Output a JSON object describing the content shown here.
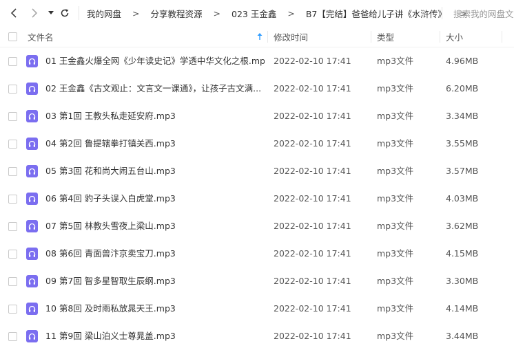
{
  "breadcrumb": {
    "items": [
      "我的网盘",
      "分享教程资源",
      "023 王金鑫",
      "B7【完结】爸爸给儿子讲《水浒传》"
    ]
  },
  "search": {
    "placeholder": "搜索我的网盘文件"
  },
  "columns": {
    "name": "文件名",
    "time": "修改时间",
    "type": "类型",
    "size": "大小"
  },
  "icons": {
    "back": "back-arrow-icon",
    "forward": "forward-arrow-icon",
    "dropdown": "dropdown-icon",
    "refresh": "refresh-icon",
    "sort": "sort-ascending-icon",
    "file": "audio-file-icon"
  },
  "colors": {
    "file_icon": "#7b6ef0",
    "sort_arrow": "#2f9cff"
  },
  "files": [
    {
      "name": "01 王金鑫火爆全网《少年读史记》学透中华文化之根.mp3",
      "time": "2022-02-10 17:41",
      "type": "mp3文件",
      "size": "4.96MB"
    },
    {
      "name": "02 王金鑫《古文观止：文言文一课通》，让孩子古文满...",
      "time": "2022-02-10 17:41",
      "type": "mp3文件",
      "size": "6.20MB"
    },
    {
      "name": "03 第1回 王教头私走延安府.mp3",
      "time": "2022-02-10 17:41",
      "type": "mp3文件",
      "size": "3.34MB"
    },
    {
      "name": "04 第2回 鲁提辖拳打镇关西.mp3",
      "time": "2022-02-10 17:41",
      "type": "mp3文件",
      "size": "3.55MB"
    },
    {
      "name": "05 第3回 花和尚大闹五台山.mp3",
      "time": "2022-02-10 17:41",
      "type": "mp3文件",
      "size": "3.57MB"
    },
    {
      "name": "06 第4回 豹子头误入白虎堂.mp3",
      "time": "2022-02-10 17:41",
      "type": "mp3文件",
      "size": "4.03MB"
    },
    {
      "name": "07 第5回 林教头雪夜上梁山.mp3",
      "time": "2022-02-10 17:41",
      "type": "mp3文件",
      "size": "3.62MB"
    },
    {
      "name": "08 第6回 青面兽汴京卖宝刀.mp3",
      "time": "2022-02-10 17:41",
      "type": "mp3文件",
      "size": "4.15MB"
    },
    {
      "name": "09 第7回 智多星智取生辰纲.mp3",
      "time": "2022-02-10 17:41",
      "type": "mp3文件",
      "size": "3.30MB"
    },
    {
      "name": "10 第8回 及时雨私放晁天王.mp3",
      "time": "2022-02-10 17:41",
      "type": "mp3文件",
      "size": "4.14MB"
    },
    {
      "name": "11 第9回 梁山泊义士尊晁盖.mp3",
      "time": "2022-02-10 17:41",
      "type": "mp3文件",
      "size": "3.44MB"
    }
  ]
}
